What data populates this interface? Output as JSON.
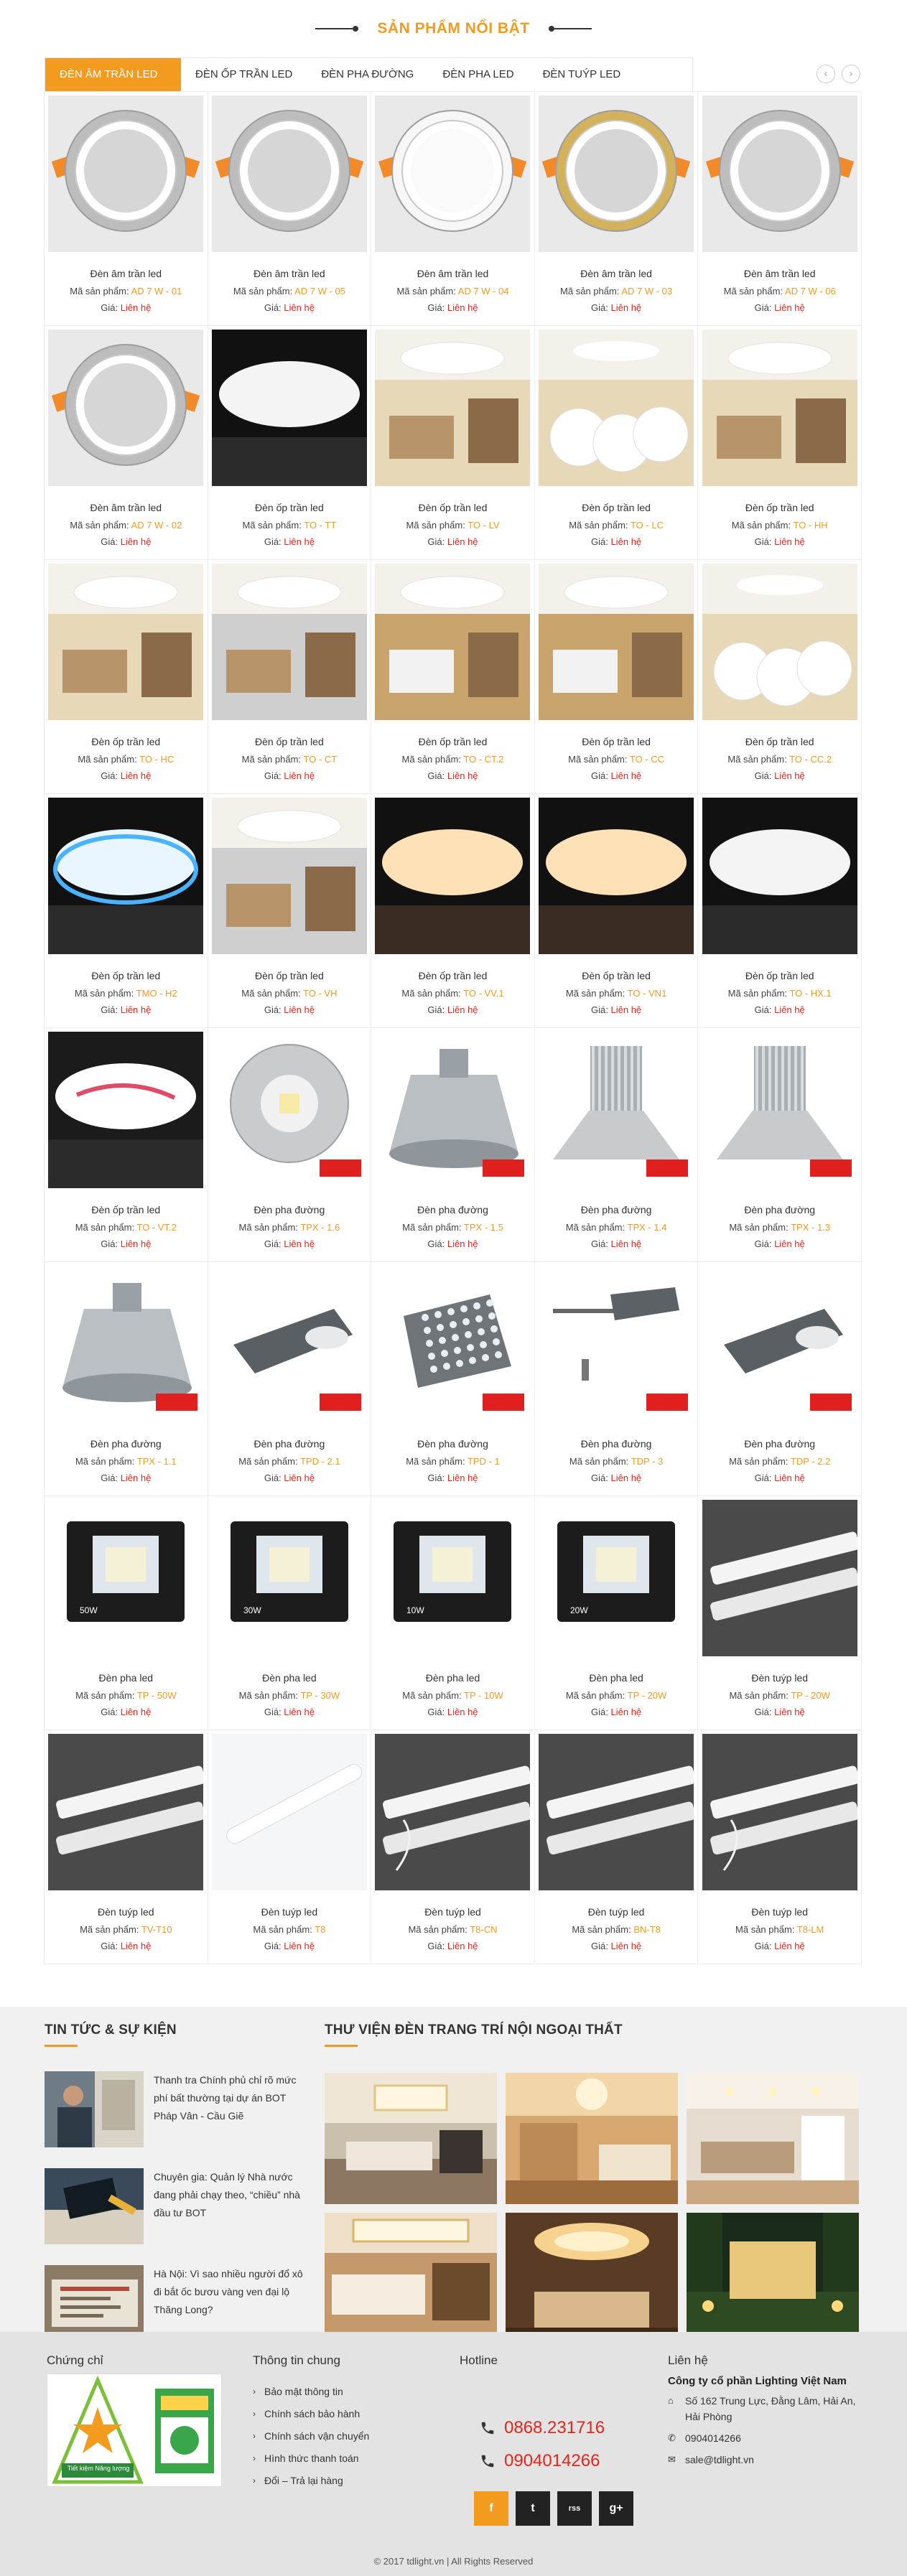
{
  "featured": {
    "title": "SẢN PHẨM NỔI BẬT",
    "tabs": [
      "ĐÈN ÂM TRẦN LED",
      "ĐÈN ỐP TRẦN LED",
      "ĐÈN PHA ĐƯỜNG",
      "ĐÈN PHA LED",
      "ĐÈN TUÝP LED"
    ],
    "arrow_prev": "‹",
    "arrow_next": "›",
    "code_label": "Mã sản phẩm:",
    "price_label": "Giá:",
    "products": [
      {
        "name": "Đèn âm trần led",
        "code": "AD 7 W - 01",
        "price": "Liên hệ",
        "img": "downlight-silver"
      },
      {
        "name": "Đèn âm trần led",
        "code": "AD 7 W - 05",
        "price": "Liên hệ",
        "img": "downlight-silver"
      },
      {
        "name": "Đèn âm trần led",
        "code": "AD 7 W - 04",
        "price": "Liên hệ",
        "img": "downlight-white"
      },
      {
        "name": "Đèn âm trần led",
        "code": "AD 7 W - 03",
        "price": "Liên hệ",
        "img": "downlight-gold"
      },
      {
        "name": "Đèn âm trần led",
        "code": "AD 7 W - 06",
        "price": "Liên hệ",
        "img": "downlight-silver"
      },
      {
        "name": "Đèn âm trần led",
        "code": "AD 7 W - 02",
        "price": "Liên hệ",
        "img": "downlight-silver"
      },
      {
        "name": "Đèn ốp trần led",
        "code": "TO - TT",
        "price": "Liên hệ",
        "img": "ceiling-dark"
      },
      {
        "name": "Đèn ốp trần led",
        "code": "TO - LV",
        "price": "Liên hệ",
        "img": "room-warm"
      },
      {
        "name": "Đèn ốp trần led",
        "code": "TO - LC",
        "price": "Liên hệ",
        "img": "room-discs"
      },
      {
        "name": "Đèn ốp trần led",
        "code": "TO - HH",
        "price": "Liên hệ",
        "img": "room-round"
      },
      {
        "name": "Đèn ốp trần led",
        "code": "TO - HC",
        "price": "Liên hệ",
        "img": "room-round"
      },
      {
        "name": "Đèn ốp trần led",
        "code": "TO - CT",
        "price": "Liên hệ",
        "img": "room-grey"
      },
      {
        "name": "Đèn ốp trần led",
        "code": "TO - CT.2",
        "price": "Liên hệ",
        "img": "kitchen"
      },
      {
        "name": "Đèn ốp trần led",
        "code": "TO - CC",
        "price": "Liên hệ",
        "img": "kitchen"
      },
      {
        "name": "Đèn ốp trần led",
        "code": "TO - CC.2",
        "price": "Liên hệ",
        "img": "room-discs"
      },
      {
        "name": "Đèn ốp trần led",
        "code": "TMO - H2",
        "price": "Liên hệ",
        "img": "ceiling-blue"
      },
      {
        "name": "Đèn ốp trần led",
        "code": "TO - VH",
        "price": "Liên hệ",
        "img": "room-grey"
      },
      {
        "name": "Đèn ốp trần led",
        "code": "TO - VV.1",
        "price": "Liên hệ",
        "img": "ceiling-warm-dark"
      },
      {
        "name": "Đèn ốp trần led",
        "code": "TO - VN1",
        "price": "Liên hệ",
        "img": "ceiling-warm-dark"
      },
      {
        "name": "Đèn ốp trần led",
        "code": "TO - HX.1",
        "price": "Liên hệ",
        "img": "ceiling-dark"
      },
      {
        "name": "Đèn ốp trần led",
        "code": "TO - VT.2",
        "price": "Liên hệ",
        "img": "ceiling-pink"
      },
      {
        "name": "Đèn pha đường",
        "code": "TPX - 1.6",
        "price": "Liên hệ",
        "img": "highbay-round"
      },
      {
        "name": "Đèn pha đường",
        "code": "TPX - 1.5",
        "price": "Liên hệ",
        "img": "highbay-cone"
      },
      {
        "name": "Đèn pha đường",
        "code": "TPX - 1.4",
        "price": "Liên hệ",
        "img": "highbay-fin"
      },
      {
        "name": "Đèn pha đường",
        "code": "TPX - 1.3",
        "price": "Liên hệ",
        "img": "highbay-fin"
      },
      {
        "name": "Đèn pha đường",
        "code": "TPX - 1.1",
        "price": "Liên hệ",
        "img": "highbay-cone"
      },
      {
        "name": "Đèn pha đường",
        "code": "TPD - 2.1",
        "price": "Liên hệ",
        "img": "street-small"
      },
      {
        "name": "Đèn pha đường",
        "code": "TPD - 1",
        "price": "Liên hệ",
        "img": "street-panel"
      },
      {
        "name": "Đèn pha đường",
        "code": "TDP - 3",
        "price": "Liên hệ",
        "img": "street-arm"
      },
      {
        "name": "Đèn pha đường",
        "code": "TDP - 2.2",
        "price": "Liên hệ",
        "img": "street-small"
      },
      {
        "name": "Đèn pha led",
        "code": "TP - 50W",
        "price": "Liên hệ",
        "img": "flood",
        "watt": "50W"
      },
      {
        "name": "Đèn pha led",
        "code": "TP - 30W",
        "price": "Liên hệ",
        "img": "flood",
        "watt": "30W"
      },
      {
        "name": "Đèn pha led",
        "code": "TP - 10W",
        "price": "Liên hệ",
        "img": "flood",
        "watt": "10W"
      },
      {
        "name": "Đèn pha led",
        "code": "TP - 20W",
        "price": "Liên hệ",
        "img": "flood",
        "watt": "20W"
      },
      {
        "name": "Đèn tuýp led",
        "code": "TP - 20W",
        "price": "Liên hệ",
        "img": "tube"
      },
      {
        "name": "Đèn tuýp led",
        "code": "TV-T10",
        "price": "Liên hệ",
        "img": "tube"
      },
      {
        "name": "Đèn tuýp led",
        "code": "T8",
        "price": "Liên hệ",
        "img": "tube-single"
      },
      {
        "name": "Đèn tuýp led",
        "code": "T8-CN",
        "price": "Liên hệ",
        "img": "tube-wires"
      },
      {
        "name": "Đèn tuýp led",
        "code": "BN-T8",
        "price": "Liên hệ",
        "img": "tube"
      },
      {
        "name": "Đèn tuýp led",
        "code": "T8-LM",
        "price": "Liên hệ",
        "img": "tube-wires"
      }
    ]
  },
  "news": {
    "title": "TIN TỨC & SỰ KIỆN",
    "items": [
      {
        "text": "Thanh tra Chính phủ chỉ rõ mức phí bất thường tại dự án BOT Pháp Vân - Cầu Giẽ",
        "img": "news-1"
      },
      {
        "text": "Chuyên gia: Quản lý Nhà nước đang phải chạy theo, “chiều” nhà đầu tư BOT",
        "img": "news-2"
      },
      {
        "text": "Hà Nội: Vì sao nhiều người đổ xô đi bắt ốc bươu vàng ven đại lộ Thăng Long?",
        "img": "news-3"
      }
    ]
  },
  "library": {
    "title": "THƯ VIỆN ĐÈN TRANG TRÍ NỘI NGOẠI THẤT",
    "images": [
      "gallery-1",
      "gallery-2",
      "gallery-3",
      "gallery-4",
      "gallery-5",
      "gallery-6"
    ]
  },
  "footer": {
    "cert_title": "Chứng chỉ",
    "cert_label": "Tiết kiệm Năng lượng",
    "info_title": "Thông tin chung",
    "links": [
      "Bảo mật thông tin",
      "Chính sách bảo hành",
      "Chính sách vận chuyển",
      "Hình thức thanh toán",
      "Đổi – Trả lại hàng"
    ],
    "hotline_title": "Hotline",
    "hotlines": [
      "0868.231716",
      "0904014266"
    ],
    "socials": [
      "f",
      "t",
      "rss",
      "g+"
    ],
    "contact_title": "Liên hệ",
    "company": "Công ty cổ phần Lighting Việt Nam",
    "address": "Số 162 Trung Lực, Đằng Lâm, Hải An, Hải Phòng",
    "phone": "0904014266",
    "email": "sale@tdlight.vn",
    "copyright": "© 2017 tdlight.vn | All Rights Reserved"
  },
  "colors": {
    "accent": "#f39b1e",
    "price": "#e5251c",
    "news_bg": "#f1f1f1",
    "footer_bg": "#e3e3e3"
  }
}
